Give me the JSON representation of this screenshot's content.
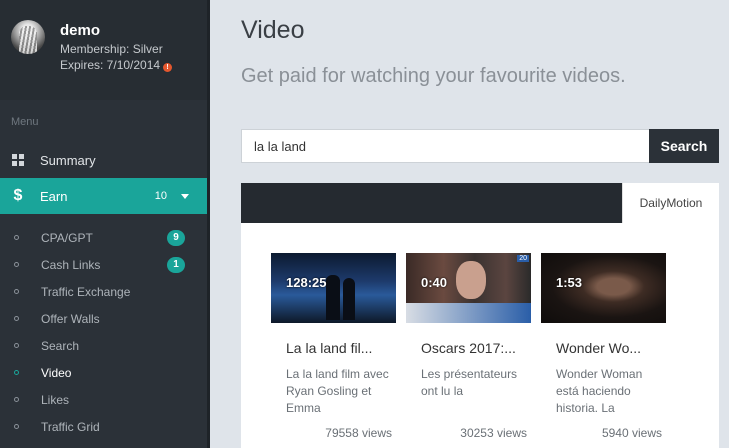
{
  "user": {
    "name": "demo",
    "membership": "Membership: Silver",
    "expires": "Expires: 7/10/2014",
    "expires_warning": "!"
  },
  "sidebar": {
    "menu_heading": "Menu",
    "summary_label": "Summary",
    "earn_label": "Earn",
    "earn_count": "10",
    "earn_icon": "$",
    "sub_items": [
      {
        "label": "CPA/GPT",
        "badge": "9"
      },
      {
        "label": "Cash Links",
        "badge": "1"
      },
      {
        "label": "Traffic Exchange"
      },
      {
        "label": "Offer Walls"
      },
      {
        "label": "Search"
      },
      {
        "label": "Video",
        "active": true
      },
      {
        "label": "Likes"
      },
      {
        "label": "Traffic Grid"
      }
    ]
  },
  "main": {
    "title": "Video",
    "subtitle": "Get paid for watching your favourite videos.",
    "search": {
      "value": "la la land",
      "button_label": "Search"
    },
    "tabs": [
      {
        "label": "DailyMotion",
        "active": true
      }
    ],
    "videos": [
      {
        "duration": "128:25",
        "title": "La la land fil...",
        "description": "La la land film avec Ryan Gosling et Emma",
        "views": "79558 views"
      },
      {
        "duration": "0:40",
        "title": "Oscars 2017:...",
        "description": "Les présentateurs ont lu la",
        "views": "30253 views",
        "thumb_tag": "20"
      },
      {
        "duration": "1:53",
        "title": "Wonder Wo...",
        "description": "Wonder Woman está haciendo historia. La",
        "views": "5940 views"
      }
    ]
  },
  "colors": {
    "accent": "#1aa59a",
    "sidebar_bg": "#2b3138",
    "header_dark": "#252a30",
    "page_bg": "#dfe4ea",
    "warning": "#e4572e"
  }
}
